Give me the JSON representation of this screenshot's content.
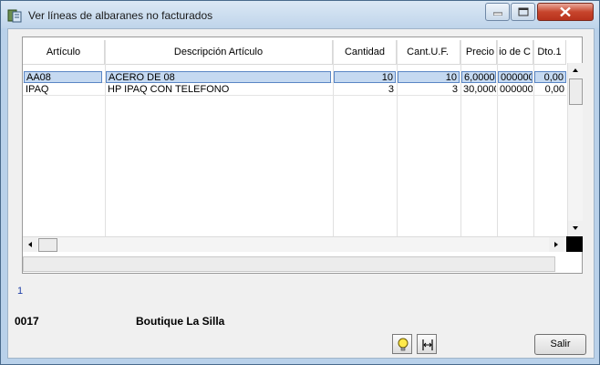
{
  "window": {
    "title": "Ver líneas de albaranes no facturados"
  },
  "grid": {
    "columns": [
      "Artículo",
      "Descripción Artículo",
      "Cantidad",
      "Cant.U.F.",
      "Precio",
      "io de C",
      "Dto.1"
    ],
    "rows": [
      {
        "articulo": "AA08",
        "descripcion": "ACERO DE 08",
        "cantidad": "10",
        "cant_uf": "10",
        "precio": "6,0000",
        "precio_c": "000000",
        "dto1": "0,00",
        "selected": true
      },
      {
        "articulo": "IPAQ",
        "descripcion": "HP IPAQ CON TELEFONO",
        "cantidad": "3",
        "cant_uf": "3",
        "precio": "30,0000",
        "precio_c": "000000",
        "dto1": "0,00",
        "selected": false
      }
    ]
  },
  "footer": {
    "count": "1",
    "client_code": "0017",
    "client_name": "Boutique La Silla",
    "exit_label": "Salir"
  },
  "icons": {
    "app": "app-icon",
    "bulb": "lightbulb-icon",
    "fit": "fit-columns-icon"
  }
}
